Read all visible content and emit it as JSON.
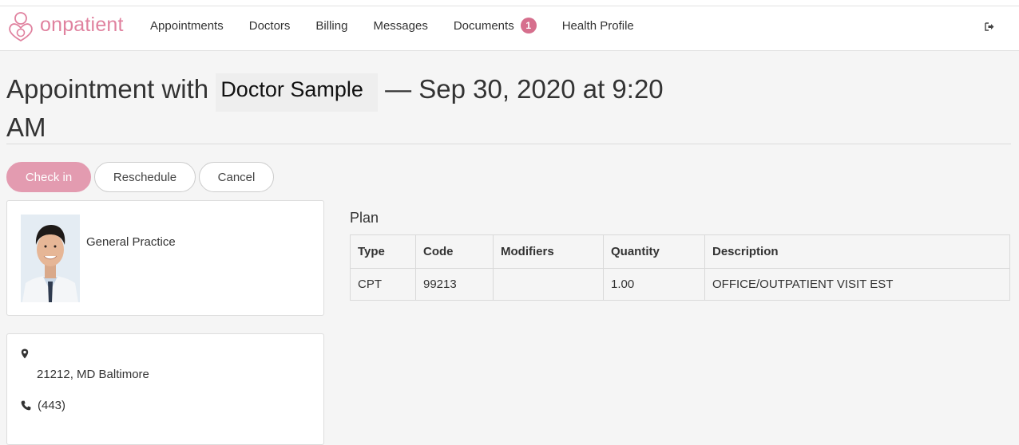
{
  "app": {
    "brand_name": "onpatient",
    "brand_color": "#e0829f"
  },
  "nav": {
    "items": [
      {
        "label": "Appointments"
      },
      {
        "label": "Doctors"
      },
      {
        "label": "Billing"
      },
      {
        "label": "Messages"
      },
      {
        "label": "Documents",
        "badge": "1"
      },
      {
        "label": "Health Profile"
      }
    ],
    "logout_icon": "sign-out-icon"
  },
  "page": {
    "title_prefix": "Appointment with",
    "doctor_name": "Doctor Sample",
    "title_suffix": "— Sep 30, 2020 at 9:20 AM"
  },
  "actions": {
    "check_in": "Check in",
    "reschedule": "Reschedule",
    "cancel": "Cancel",
    "primary_color": "#e39bb0"
  },
  "doctor": {
    "specialty": "General Practice",
    "photo_icon": "doctor-photo"
  },
  "contact": {
    "location_icon": "map-marker-icon",
    "address": "21212, MD Baltimore",
    "phone_icon": "phone-icon",
    "phone": "(443)"
  },
  "plan": {
    "heading": "Plan",
    "columns": [
      "Type",
      "Code",
      "Modifiers",
      "Quantity",
      "Description"
    ],
    "rows": [
      [
        "CPT",
        "99213",
        "",
        "1.00",
        "OFFICE/OUTPATIENT VISIT EST"
      ]
    ]
  }
}
